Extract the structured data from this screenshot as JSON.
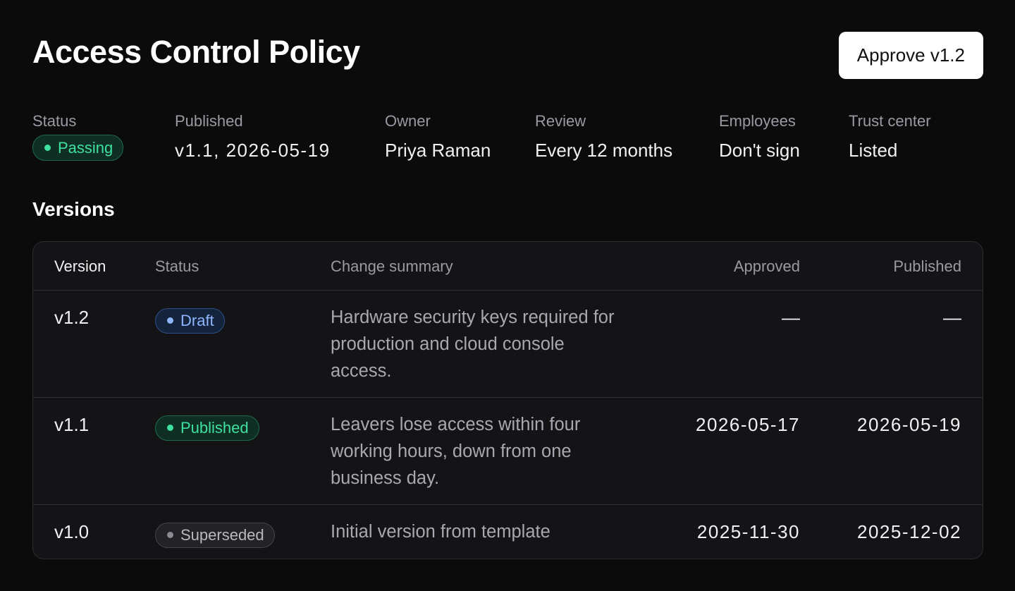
{
  "header": {
    "title": "Access Control Policy",
    "approve_label": "Approve v1.2"
  },
  "meta": {
    "status": {
      "label": "Status",
      "value": "Passing"
    },
    "published": {
      "label": "Published",
      "value": "v1.1, 2026-05-19"
    },
    "owner": {
      "label": "Owner",
      "value": "Priya Raman"
    },
    "review": {
      "label": "Review",
      "value": "Every 12 months"
    },
    "employees": {
      "label": "Employees",
      "value": "Don't sign"
    },
    "trust_center": {
      "label": "Trust center",
      "value": "Listed"
    }
  },
  "versions": {
    "title": "Versions",
    "columns": {
      "version": "Version",
      "status": "Status",
      "summary": "Change summary",
      "approved": "Approved",
      "published": "Published"
    },
    "rows": [
      {
        "version": "v1.2",
        "status": "Draft",
        "summary": "Hardware security keys required for production and cloud console access.",
        "approved": "—",
        "published": "—"
      },
      {
        "version": "v1.1",
        "status": "Published",
        "summary": "Leavers lose access within four working hours, down from one business day.",
        "approved": "2026-05-17",
        "published": "2026-05-19"
      },
      {
        "version": "v1.0",
        "status": "Superseded",
        "summary": "Initial version from template",
        "approved": "2025-11-30",
        "published": "2025-12-02"
      }
    ]
  },
  "colors": {
    "background": "#0b0b0c",
    "passing": "#3ee0a0",
    "draft": "#8fb6ff",
    "superseded": "#8a8a92"
  }
}
